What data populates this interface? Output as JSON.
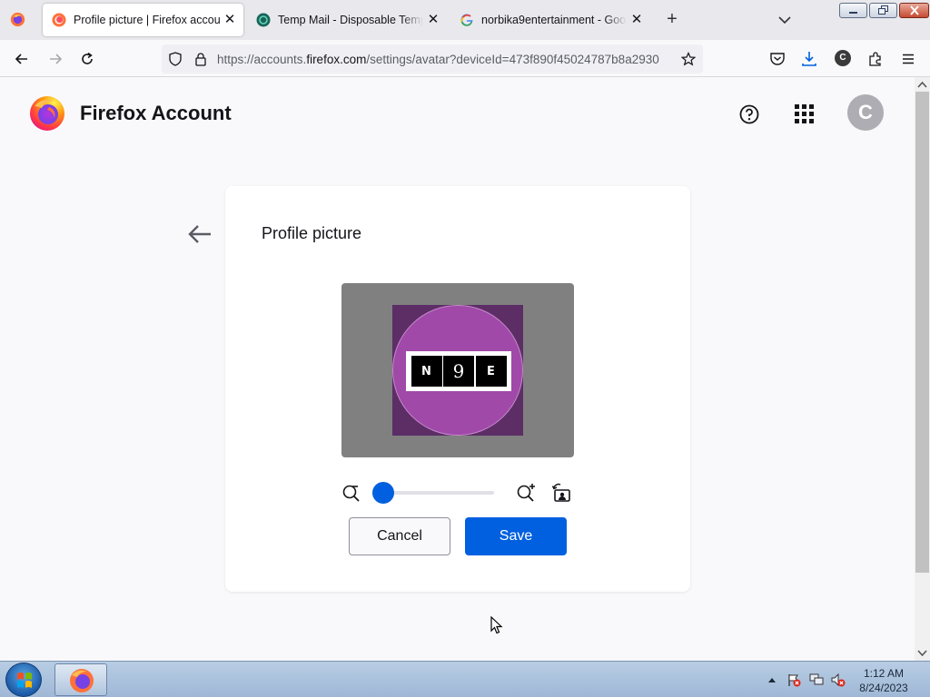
{
  "browser": {
    "tabs": [
      {
        "title": "Profile picture | Firefox accounts",
        "favicon": "firefox-accounts-icon",
        "active": true
      },
      {
        "title": "Temp Mail - Disposable Tempor",
        "favicon": "temp-mail-icon",
        "active": false
      },
      {
        "title": "norbika9entertainment - Googl",
        "favicon": "google-icon",
        "active": false
      }
    ],
    "url_prefix": "https://accounts.",
    "url_domain": "firefox.com",
    "url_suffix": "/settings/avatar?deviceId=473f890f45024787b8a2930",
    "account_initial": "C"
  },
  "header": {
    "brand": "Firefox Account",
    "avatar_initial": "C"
  },
  "card": {
    "title": "Profile picture",
    "image_text": [
      "N",
      "9",
      "E"
    ],
    "zoom_level": 0,
    "cancel_label": "Cancel",
    "save_label": "Save"
  },
  "taskbar": {
    "time": "1:12 AM",
    "date": "8/24/2023"
  },
  "colors": {
    "accent": "#0060df",
    "avatar_circle": "#a049a8",
    "avatar_square": "#5d2d66"
  }
}
